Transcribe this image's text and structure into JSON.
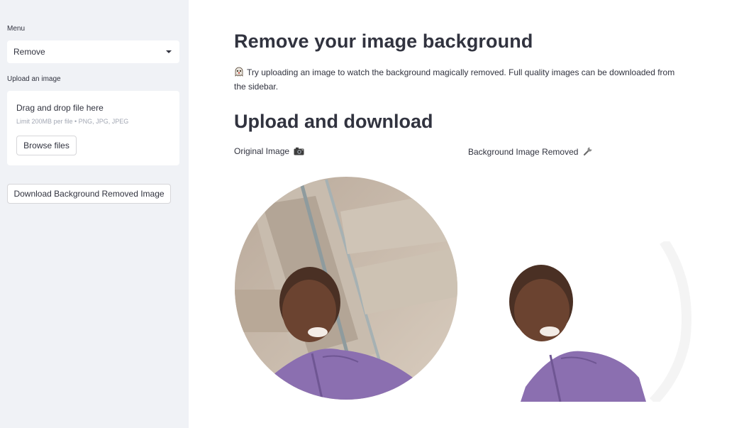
{
  "sidebar": {
    "menu_label": "Menu",
    "menu_select": {
      "value": "Remove"
    },
    "upload_label": "Upload an image",
    "dropzone": {
      "title": "Drag and drop file here",
      "limit": "Limit 200MB per file • PNG, JPG, JPEG",
      "browse_label": "Browse files"
    },
    "download_label": "Download Background Removed Image"
  },
  "main": {
    "title": "Remove your image background",
    "intro_icon": "ghost-icon",
    "intro_text": "Try uploading an image to watch the background magically removed. Full quality images can be downloaded from the sidebar.",
    "section_title": "Upload and download",
    "original_label": "Original Image",
    "original_icon": "camera-icon",
    "removed_label": "Background Image Removed",
    "removed_icon": "wrench-icon"
  },
  "colors": {
    "sidebar_bg": "#f0f2f6",
    "text": "#31333f",
    "muted": "#a3a8b4",
    "shirt": "#8b6fb0"
  }
}
